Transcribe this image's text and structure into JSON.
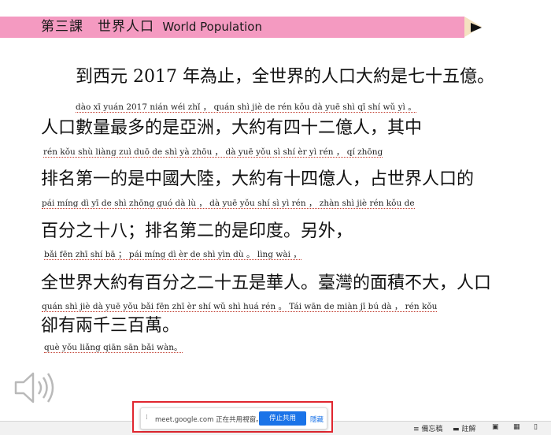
{
  "header": {
    "title_zh": "第三課　世界人口",
    "title_en": "World Population"
  },
  "lines": [
    {
      "text": "　　到西元 2017 年為止，全世界的人口大約是七十五億。",
      "pinyin": "dào  xī  yuán       2017        nián wéi  zhǐ ，    quán  shì  jiè   de    rén kǒu  dà  yuē  shì   qī   shí   wǔ   yì 。"
    },
    {
      "text": "人口數量最多的是亞洲，大約有四十二億人，其中",
      "pinyin": "rén  kǒu shù liàng  zuì  duō   de    shì  yà  zhōu ，    dà  yuē yǒu   sì    shí    èr   yì    rén ，    qí  zhōng"
    },
    {
      "text": "排名第一的是中國大陸，大約有十四億人，占世界人口的",
      "pinyin": "pái míng  dì   yī    de   shì zhōng guó  dà   lù ，      dà  yuē  yǒu shí     sì   yì   rén ，   zhàn shì  jiè  rén  kǒu   de"
    },
    {
      "text": "百分之十八；排名第二的是印度。另外，",
      "pinyin": "bǎi  fēn   zhī  shí   bā ；    pái  míng  dì   èr     de   shì  yìn  dù 。      lìng  wài ，"
    },
    {
      "text": "全世界大約有百分之二十五是華人。臺灣的面積不大，人口",
      "pinyin": "quán shì  jiè  dà  yuē  yǒu  bǎi  fēn   zhī   èr   shí  wǔ  shì  huá  rén 。    Tái  wān  de  miàn  jī     bú  dà ，       rén  kǒu"
    },
    {
      "text": "卻有兩千三百萬。",
      "pinyin": "què  yǒu liǎng qiān sān    bǎi  wàn。"
    }
  ],
  "share": {
    "message": "meet.google.com 正在共用視窗。",
    "stop_label": "停止共用",
    "hide_label": "隱藏"
  },
  "status": {
    "notes": "備忘稿",
    "comments": "註解"
  },
  "colors": {
    "banner": "#f49ac1",
    "stop_button": "#1a73e8",
    "highlight_border": "#e0262f"
  }
}
